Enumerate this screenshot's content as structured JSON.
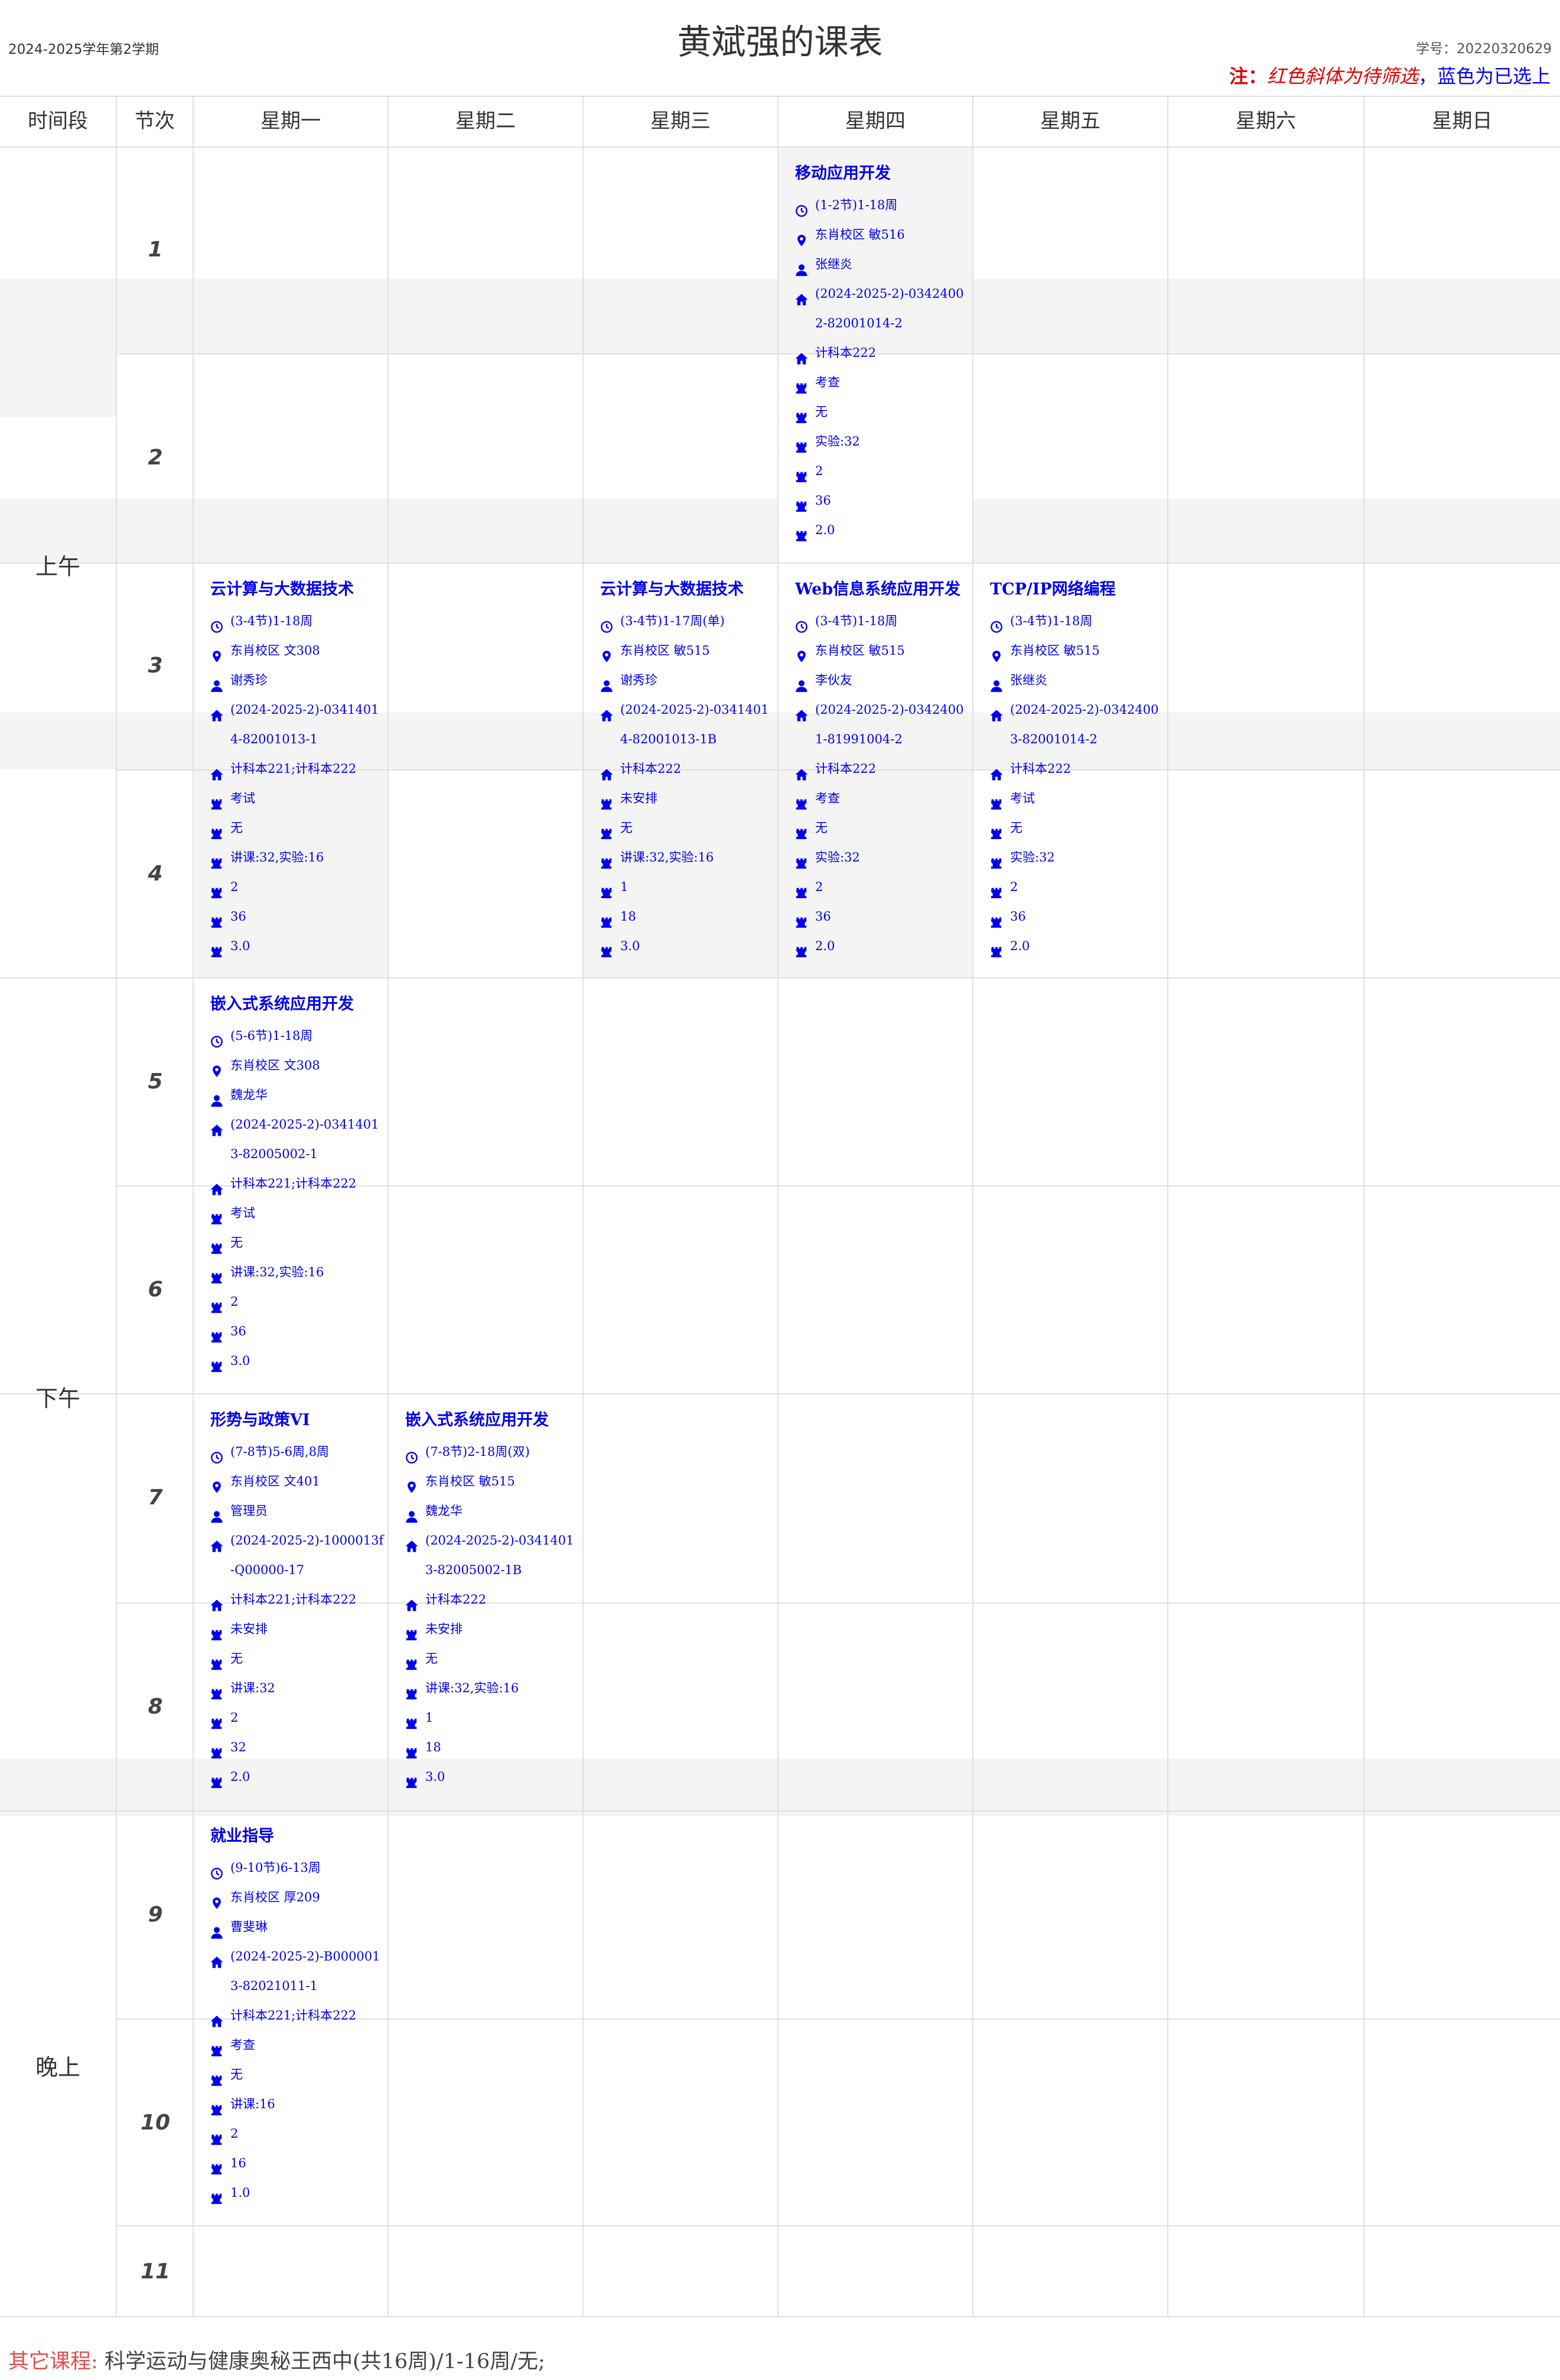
{
  "header": {
    "term": "2024-2025学年第2学期",
    "title": "黄斌强的课表",
    "student_id": "学号：20220320629",
    "note_key": "注：",
    "note_red": "红色斜体为待筛选",
    "note_sep": "，",
    "note_blue": "蓝色为已选上"
  },
  "columns": [
    "时间段",
    "节次",
    "星期一",
    "星期二",
    "星期三",
    "星期四",
    "星期五",
    "星期六",
    "星期日"
  ],
  "periods": [
    "上午",
    "下午",
    "晚上"
  ],
  "sections": [
    "1",
    "2",
    "3",
    "4",
    "5",
    "6",
    "7",
    "8",
    "9",
    "10",
    "11"
  ],
  "courses": [
    {
      "name": "移动应用开发",
      "time": "(1-2节)1-18周",
      "place": "东肖校区 敏516",
      "teacher": "张继炎",
      "code": "(2024-2025-2)-03424002-82001014-2",
      "class": "计科本222",
      "exam": "考查",
      "extra": "无",
      "hours": "实验:32",
      "weekly": "2",
      "total": "36",
      "credit": "2.0"
    },
    {
      "name": "云计算与大数据技术",
      "time": "(3-4节)1-18周",
      "place": "东肖校区 文308",
      "teacher": "谢秀珍",
      "code": "(2024-2025-2)-03414014-82001013-1",
      "class": "计科本221;计科本222",
      "exam": "考试",
      "extra": "无",
      "hours": "讲课:32,实验:16",
      "weekly": "2",
      "total": "36",
      "credit": "3.0"
    },
    {
      "name": "云计算与大数据技术",
      "time": "(3-4节)1-17周(单)",
      "place": "东肖校区 敏515",
      "teacher": "谢秀珍",
      "code": "(2024-2025-2)-03414014-82001013-1B",
      "class": "计科本222",
      "exam": "未安排",
      "extra": "无",
      "hours": "讲课:32,实验:16",
      "weekly": "1",
      "total": "18",
      "credit": "3.0"
    },
    {
      "name": "Web信息系统应用开发",
      "time": "(3-4节)1-18周",
      "place": "东肖校区 敏515",
      "teacher": "李伙友",
      "code": "(2024-2025-2)-03424001-81991004-2",
      "class": "计科本222",
      "exam": "考查",
      "extra": "无",
      "hours": "实验:32",
      "weekly": "2",
      "total": "36",
      "credit": "2.0"
    },
    {
      "name": "TCP/IP网络编程",
      "time": "(3-4节)1-18周",
      "place": "东肖校区 敏515",
      "teacher": "张继炎",
      "code": "(2024-2025-2)-03424003-82001014-2",
      "class": "计科本222",
      "exam": "考试",
      "extra": "无",
      "hours": "实验:32",
      "weekly": "2",
      "total": "36",
      "credit": "2.0"
    },
    {
      "name": "嵌入式系统应用开发",
      "time": "(5-6节)1-18周",
      "place": "东肖校区 文308",
      "teacher": "魏龙华",
      "code": "(2024-2025-2)-03414013-82005002-1",
      "class": "计科本221;计科本222",
      "exam": "考试",
      "extra": "无",
      "hours": "讲课:32,实验:16",
      "weekly": "2",
      "total": "36",
      "credit": "3.0"
    },
    {
      "name": "形势与政策VI",
      "time": "(7-8节)5-6周,8周",
      "place": "东肖校区 文401",
      "teacher": "管理员",
      "code": "(2024-2025-2)-1000013f-Q00000-17",
      "class": "计科本221;计科本222",
      "exam": "未安排",
      "extra": "无",
      "hours": "讲课:32",
      "weekly": "2",
      "total": "32",
      "credit": "2.0"
    },
    {
      "name": "嵌入式系统应用开发",
      "time": "(7-8节)2-18周(双)",
      "place": "东肖校区 敏515",
      "teacher": "魏龙华",
      "code": "(2024-2025-2)-03414013-82005002-1B",
      "class": "计科本222",
      "exam": "未安排",
      "extra": "无",
      "hours": "讲课:32,实验:16",
      "weekly": "1",
      "total": "18",
      "credit": "3.0"
    },
    {
      "name": "就业指导",
      "time": "(9-10节)6-13周",
      "place": "东肖校区 厚209",
      "teacher": "曹斐琳",
      "code": "(2024-2025-2)-B0000013-82021011-1",
      "class": "计科本221;计科本222",
      "exam": "考查",
      "extra": "无",
      "hours": "讲课:16",
      "weekly": "2",
      "total": "16",
      "credit": "1.0"
    }
  ],
  "other_courses": {
    "label": "其它课程:",
    "value": "科学运动与健康奥秘王西中(共16周)/1-16周/无;"
  },
  "colors": {
    "selected": "#0000ee",
    "pending": "#e00000",
    "grid": "#e0e0e0",
    "stripe": "#f4f4f4"
  },
  "icons": [
    "clock-icon",
    "location-icon",
    "teacher-icon",
    "home-icon",
    "crown-icon"
  ]
}
